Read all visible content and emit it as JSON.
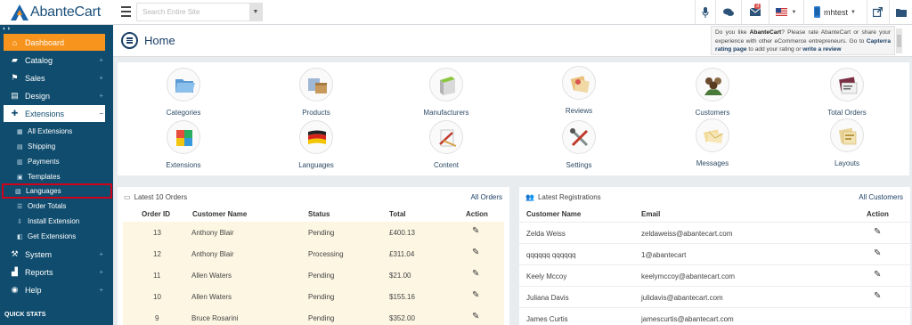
{
  "app": {
    "name": "AbanteCart"
  },
  "search": {
    "placeholder": "Search Entire Site"
  },
  "topbar": {
    "alert_count": "3",
    "user_name": "mhtest"
  },
  "sidebar": {
    "items": [
      {
        "label": "Dashboard",
        "icon": "home-icon"
      },
      {
        "label": "Catalog",
        "icon": "folder-icon"
      },
      {
        "label": "Sales",
        "icon": "flag-icon"
      },
      {
        "label": "Design",
        "icon": "file-icon"
      },
      {
        "label": "Extensions",
        "icon": "puzzle-icon"
      },
      {
        "label": "System",
        "icon": "wrench-icon"
      },
      {
        "label": "Reports",
        "icon": "chart-icon"
      },
      {
        "label": "Help",
        "icon": "globe-icon"
      }
    ],
    "sub_items": [
      {
        "label": "All Extensions"
      },
      {
        "label": "Shipping"
      },
      {
        "label": "Payments"
      },
      {
        "label": "Templates"
      },
      {
        "label": "Languages"
      },
      {
        "label": "Order Totals"
      },
      {
        "label": "Install Extension"
      },
      {
        "label": "Get Extensions"
      }
    ],
    "quick_stats": "QUICK STATS"
  },
  "header": {
    "title": "Home",
    "rating_text_1": "Do you like ",
    "rating_brand": "AbanteCart",
    "rating_text_2": "? Please rate AbanteCart or share your experience with other eCommerce entrepreneurs. Go to ",
    "rating_link_1": "Capterra rating page",
    "rating_text_3": " to add your rating or ",
    "rating_link_2": "write a review"
  },
  "shortcuts": [
    {
      "label": "Categories",
      "icon": "categories-icon"
    },
    {
      "label": "Products",
      "icon": "products-icon"
    },
    {
      "label": "Manufacturers",
      "icon": "manufacturers-icon"
    },
    {
      "label": "Reviews",
      "icon": "reviews-icon"
    },
    {
      "label": "Customers",
      "icon": "customers-icon"
    },
    {
      "label": "Total Orders",
      "icon": "orders-icon"
    },
    {
      "label": "Extensions",
      "icon": "extensions-icon"
    },
    {
      "label": "Languages",
      "icon": "languages-icon"
    },
    {
      "label": "Content",
      "icon": "content-icon"
    },
    {
      "label": "Settings",
      "icon": "settings-icon"
    },
    {
      "label": "Messages",
      "icon": "messages-icon"
    },
    {
      "label": "Layouts",
      "icon": "layouts-icon"
    }
  ],
  "orders": {
    "title": "Latest 10 Orders",
    "link": "All Orders",
    "columns": [
      "Order ID",
      "Customer Name",
      "Status",
      "Total",
      "Action"
    ],
    "rows": [
      {
        "id": "13",
        "customer": "Anthony Blair",
        "status": "Pending",
        "total": "£400.13"
      },
      {
        "id": "12",
        "customer": "Anthony Blair",
        "status": "Processing",
        "total": "£311.04"
      },
      {
        "id": "11",
        "customer": "Allen Waters",
        "status": "Pending",
        "total": "$21.00"
      },
      {
        "id": "10",
        "customer": "Allen Waters",
        "status": "Pending",
        "total": "$155.16"
      },
      {
        "id": "9",
        "customer": "Bruce Rosarini",
        "status": "Pending",
        "total": "$352.00"
      }
    ]
  },
  "registrations": {
    "title": "Latest Registrations",
    "link": "All Customers",
    "columns": [
      "Customer Name",
      "Email",
      "Action"
    ],
    "rows": [
      {
        "name": "Zelda Weiss",
        "email": "zeldaweiss@abantecart.com"
      },
      {
        "name": "qqqqqq qqqqqq",
        "email": "1@abantecart"
      },
      {
        "name": "Keely Mccoy",
        "email": "keelymccoy@abantecart.com"
      },
      {
        "name": "Juliana Davis",
        "email": "julidavis@abantecart.com"
      },
      {
        "name": "James Curtis",
        "email": "jamescurtis@abantecart.com"
      }
    ]
  }
}
